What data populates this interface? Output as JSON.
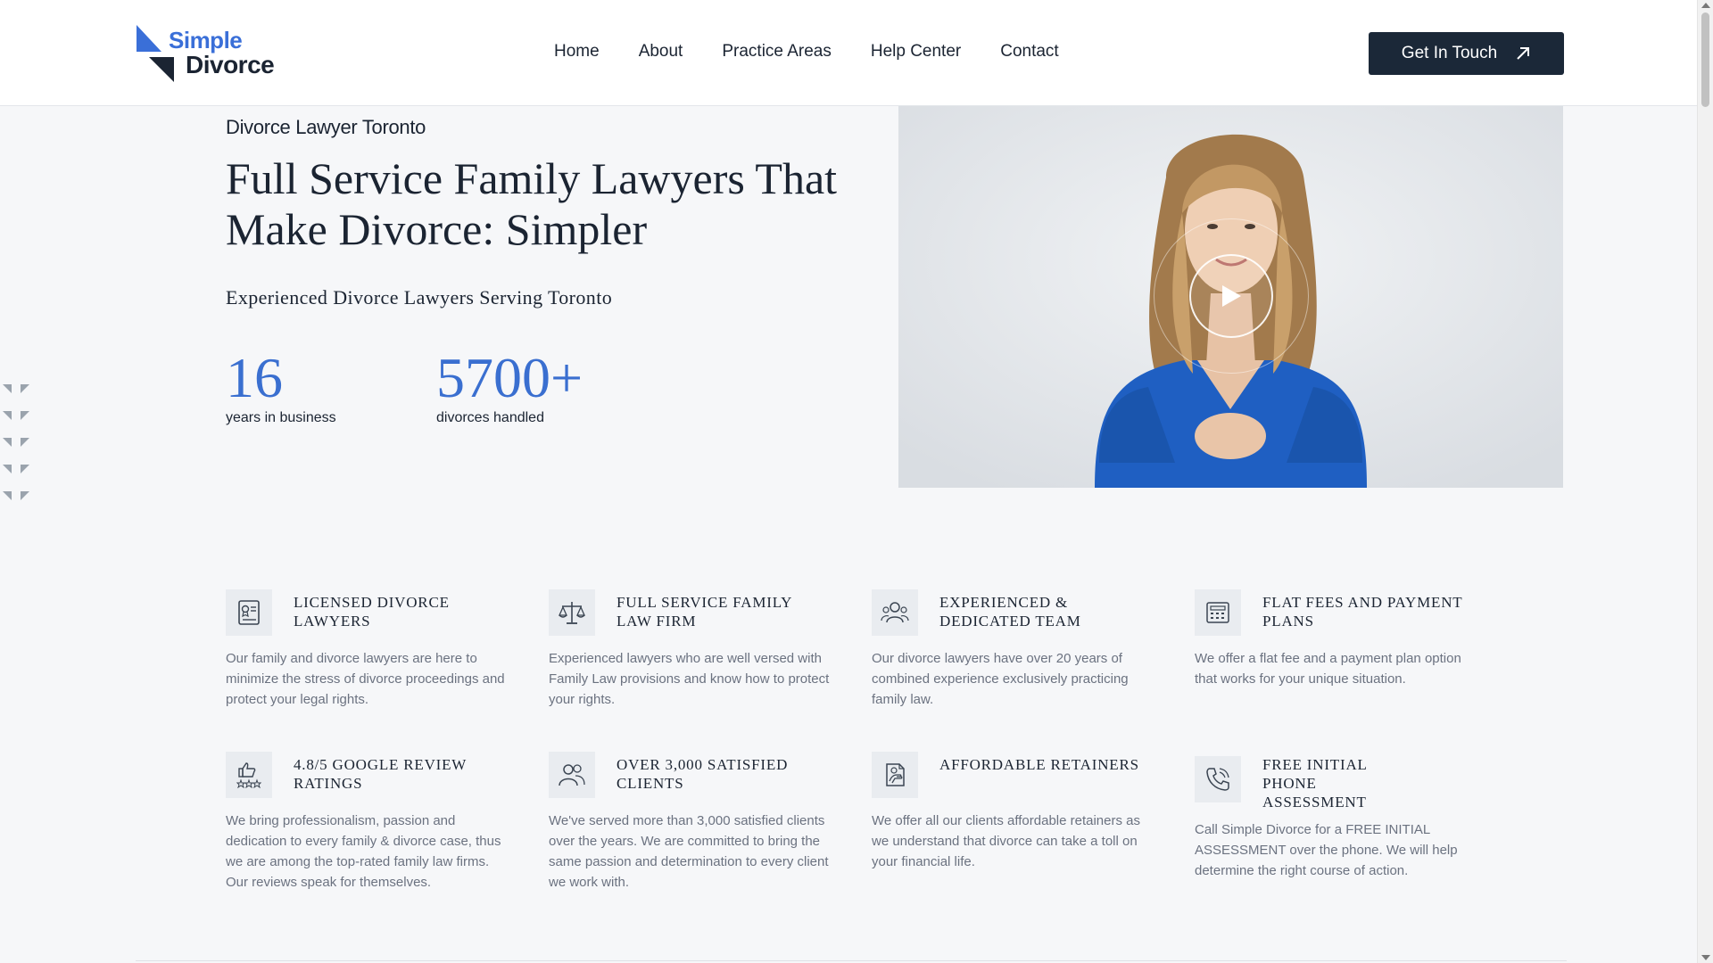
{
  "brand": {
    "line1": "Simple",
    "line2": "Divorce",
    "primary_color": "#3a6fd8",
    "dark_color": "#1b2432"
  },
  "nav": {
    "items": [
      {
        "label": "Home"
      },
      {
        "label": "About"
      },
      {
        "label": "Practice Areas"
      },
      {
        "label": "Help Center"
      },
      {
        "label": "Contact"
      }
    ],
    "cta_label": "Get In Touch"
  },
  "hero": {
    "eyebrow": "Divorce Lawyer Toronto",
    "title": "Full Service Family Lawyers That Make Divorce: Simpler",
    "subtitle": "Experienced Divorce Lawyers Serving Toronto",
    "stats": [
      {
        "value": "16",
        "label": "years in business"
      },
      {
        "value": "5700+",
        "label": "divorces handled"
      }
    ]
  },
  "video": {
    "icon": "play-icon"
  },
  "features": [
    {
      "icon": "certificate-icon",
      "title": "Licensed Divorce Lawyers",
      "desc": "Our family and divorce lawyers are here to minimize the stress of divorce proceedings and protect your legal rights."
    },
    {
      "icon": "scales-icon",
      "title": "Full Service Family Law Firm",
      "desc": "Experienced lawyers who are well versed with Family Law provisions and know how to protect your rights."
    },
    {
      "icon": "team-icon",
      "title": "Experienced & Dedicated Team",
      "desc": "Our divorce lawyers have over 20 years of combined experience exclusively practicing family law."
    },
    {
      "icon": "calculator-icon",
      "title": "Flat Fees and Payment Plans",
      "desc": "We offer a flat fee and a payment plan option that works for your unique situation."
    },
    {
      "icon": "thumbs-up-stars-icon",
      "title": "4.8/5 Google Review Ratings",
      "desc": "We bring professionalism, passion and dedication to every family & divorce case, thus we are among the top-rated family law firms. Our reviews speak for themselves."
    },
    {
      "icon": "clients-icon",
      "title": "Over 3,000 Satisfied Clients",
      "desc": "We've served more than 3,000 satisfied clients over the years. We are committed to bring the same passion and determination to every client we work with."
    },
    {
      "icon": "document-hand-icon",
      "title": "Affordable Retainers",
      "desc": "We offer all our clients affordable retainers as we understand that divorce can take a toll on your financial life."
    },
    {
      "icon": "phone-icon",
      "title": "Free Initial Phone Assessment",
      "desc": "Call Simple Divorce for a FREE INITIAL ASSESSMENT over the phone. We will help determine the right course of action."
    }
  ]
}
